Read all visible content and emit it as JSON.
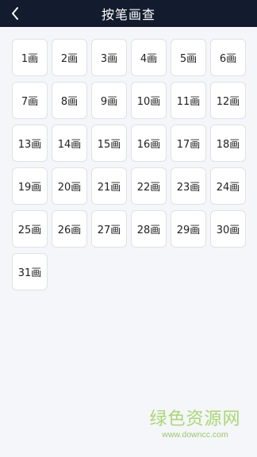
{
  "header": {
    "title": "按笔画查",
    "back_icon": "chevron-left-icon"
  },
  "strokes": [
    "1画",
    "2画",
    "3画",
    "4画",
    "5画",
    "6画",
    "7画",
    "8画",
    "9画",
    "10画",
    "11画",
    "12画",
    "13画",
    "14画",
    "15画",
    "16画",
    "17画",
    "18画",
    "19画",
    "20画",
    "21画",
    "22画",
    "23画",
    "24画",
    "25画",
    "26画",
    "27画",
    "28画",
    "29画",
    "30画",
    "31画"
  ],
  "watermark": {
    "text": "绿色资源网",
    "url": "www.downcc.com"
  },
  "colors": {
    "header_bg": "#121c2e",
    "page_bg": "#f4f6f9",
    "watermark": "#9fd25a"
  }
}
